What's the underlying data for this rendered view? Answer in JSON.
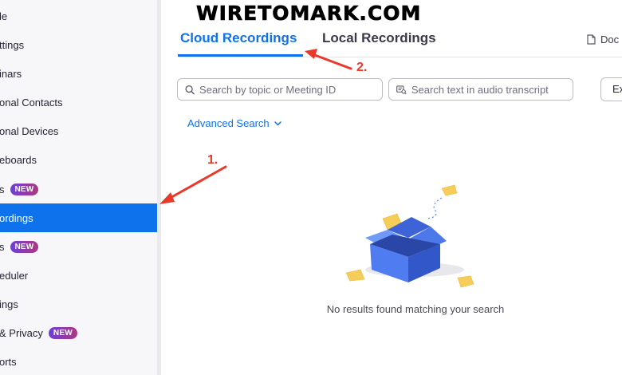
{
  "watermark": "WIRETOMARK.COM",
  "sidebar": {
    "items": [
      {
        "label": "le",
        "badge": ""
      },
      {
        "label": "ttings",
        "badge": ""
      },
      {
        "label": "inars",
        "badge": ""
      },
      {
        "label": "onal Contacts",
        "badge": ""
      },
      {
        "label": "onal Devices",
        "badge": ""
      },
      {
        "label": "eboards",
        "badge": ""
      },
      {
        "label": "s",
        "badge": "NEW"
      },
      {
        "label": "ordings",
        "badge": "",
        "active": true
      },
      {
        "label": "s",
        "badge": "NEW"
      },
      {
        "label": "eduler",
        "badge": ""
      },
      {
        "label": "ings",
        "badge": ""
      },
      {
        "label": "& Privacy",
        "badge": "NEW"
      },
      {
        "label": "orts",
        "badge": ""
      }
    ]
  },
  "tabs": {
    "cloud": "Cloud Recordings",
    "local": "Local Recordings",
    "doc": "Doc"
  },
  "search": {
    "topic_placeholder": "Search by topic or Meeting ID",
    "transcript_placeholder": "Search text in audio transcript",
    "export_label": "Ex"
  },
  "advanced_search": "Advanced Search",
  "empty_state": "No results found matching your search",
  "annotations": {
    "one": "1.",
    "two": "2."
  },
  "colors": {
    "accent": "#0e72ed",
    "annotation": "#e8392b",
    "badge_start": "#6b3fd8",
    "badge_end": "#b0377f"
  }
}
